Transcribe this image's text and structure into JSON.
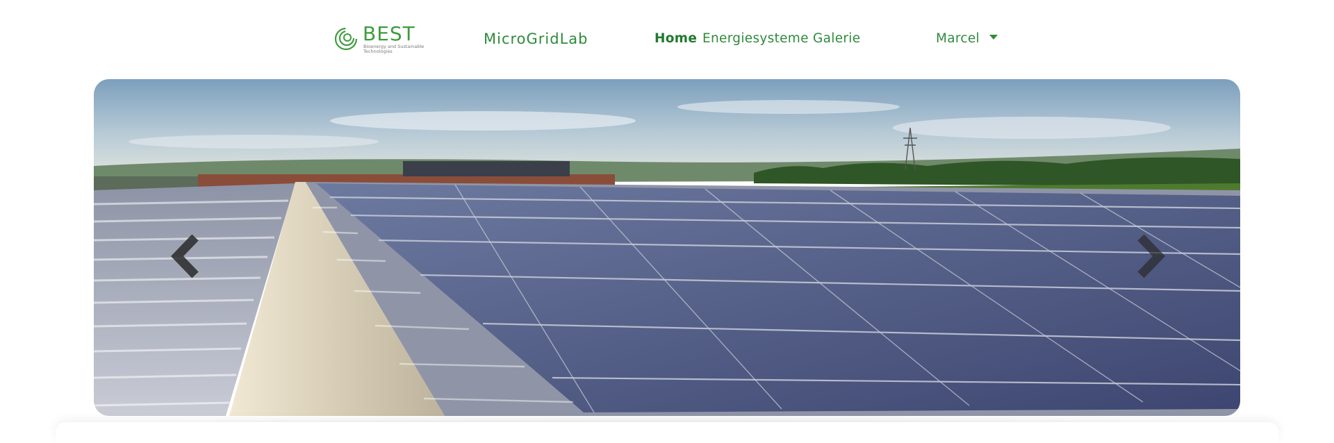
{
  "nav": {
    "logo": {
      "title": "BEST",
      "subtitle": "Bioenergy and Sustainable Technologies"
    },
    "brand": "MicroGridLab",
    "links": [
      {
        "label": "Home",
        "active": true
      },
      {
        "label": "Energiesysteme",
        "active": false
      },
      {
        "label": "Galerie",
        "active": false
      }
    ],
    "user": {
      "label": "Marcel",
      "icon": "caret-down-icon"
    }
  },
  "carousel": {
    "slide_index": 1,
    "image": "solar panels on roof next to green field",
    "prev_icon": "chevron-left-icon",
    "next_icon": "chevron-right-icon"
  },
  "colors": {
    "accent": "#2f8a3c",
    "accent_active": "#1f7a2f",
    "logo_green": "#3e9b3e"
  }
}
